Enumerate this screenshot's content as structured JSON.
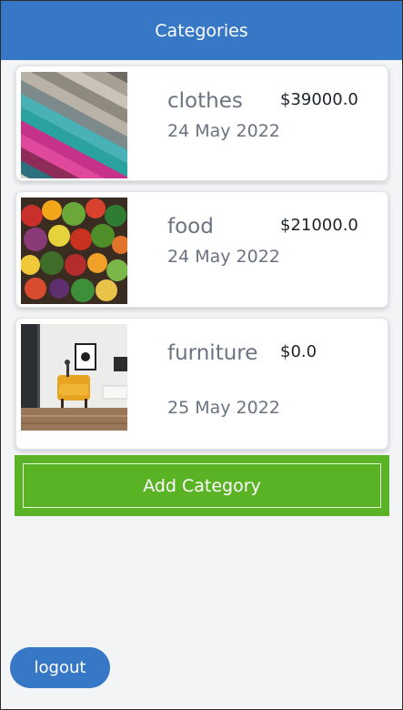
{
  "header": {
    "title": "Categories"
  },
  "categories": [
    {
      "name": "clothes",
      "date": "24 May 2022",
      "price": "$39000.0",
      "image": "fabric-swatches-image"
    },
    {
      "name": "food",
      "date": "24 May 2022",
      "price": "$21000.0",
      "image": "vegetables-image"
    },
    {
      "name": "furniture",
      "date": "25 May 2022",
      "price": "$0.0",
      "image": "living-room-image"
    }
  ],
  "actions": {
    "add_category_label": "Add Category",
    "logout_label": "logout"
  },
  "colors": {
    "header": "#3778c6",
    "add_button": "#5ab325",
    "logout_button": "#3778c6",
    "background": "#f3f4f6"
  }
}
